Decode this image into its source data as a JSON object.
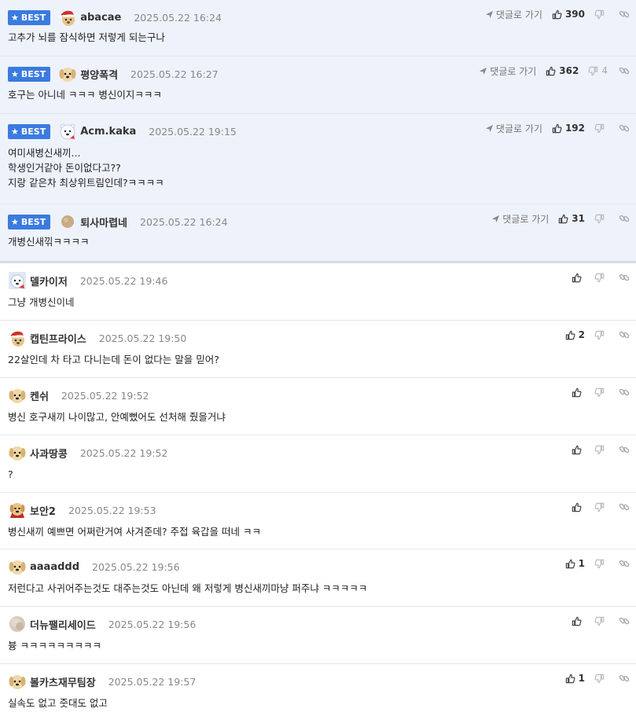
{
  "ui": {
    "best_label": "BEST",
    "reply_link_label": "댓글로 가기"
  },
  "comments": [
    {
      "best": true,
      "avatar": "santa-hat-dog",
      "name": "abacae",
      "date": "2025.05.22 16:24",
      "text": "고추가 뇌를 잠식하면 저렇게 되는구나",
      "likes": "390",
      "dislikes": ""
    },
    {
      "best": true,
      "avatar": "puppy",
      "name": "평양폭격",
      "date": "2025.05.22 16:27",
      "text": "호구는 아니네 ㅋㅋㅋ 병신이지ㅋㅋㅋ",
      "likes": "362",
      "dislikes": "4"
    },
    {
      "best": true,
      "avatar": "polar-bear",
      "name": "Acm.kaka",
      "date": "2025.05.22 19:15",
      "text": "여미새병신새끼...\n학생인거같아 돈이없다고??\n지랑 같은차 최상위트림인데?ㅋㅋㅋㅋ",
      "likes": "192",
      "dislikes": ""
    },
    {
      "best": true,
      "avatar": "round-dot",
      "name": "퇴사마렵네",
      "date": "2025.05.22 16:24",
      "text": "개병신새끾ㅋㅋㅋㅋ",
      "likes": "31",
      "dislikes": ""
    },
    {
      "best": false,
      "avatar": "polar-bear",
      "name": "델카이저",
      "date": "2025.05.22 19:46",
      "text": "그냥 개병신이네",
      "likes": "",
      "dislikes": ""
    },
    {
      "best": false,
      "avatar": "santa-hat-dog",
      "name": "캡틴프라이스",
      "date": "2025.05.22 19:50",
      "text": "22살인데 차 타고 다니는데 돈이 없다는 말을 믿어?",
      "likes": "2",
      "dislikes": ""
    },
    {
      "best": false,
      "avatar": "puppy",
      "name": "켄쉬",
      "date": "2025.05.22 19:52",
      "text": "병신 호구새끼 나이많고, 안예뻤어도 선처해 줬을거냐",
      "likes": "",
      "dislikes": ""
    },
    {
      "best": false,
      "avatar": "puppy",
      "name": "사과땅콩",
      "date": "2025.05.22 19:52",
      "text": "?",
      "likes": "",
      "dislikes": ""
    },
    {
      "best": false,
      "avatar": "cape-dog",
      "name": "보안2",
      "date": "2025.05.22 19:53",
      "text": "병신새끼 예쁘면 어쩌란거여 사겨준데? 주접 육갑을 떠네 ㅋㅋ",
      "likes": "",
      "dislikes": ""
    },
    {
      "best": false,
      "avatar": "puppy",
      "name": "aaaaddd",
      "date": "2025.05.22 19:56",
      "text": "저런다고 사귀어주는것도 대주는것도 아닌데 왜 저렇게 병신새끼마냥 퍼주냐 ㅋㅋㅋㅋㅋ",
      "likes": "1",
      "dislikes": ""
    },
    {
      "best": false,
      "avatar": "blurred-face",
      "name": "더뉴팰리세이드",
      "date": "2025.05.22 19:56",
      "text": "븅 ㅋㅋㅋㅋㅋㅋㅋㅋㅋ",
      "likes": "",
      "dislikes": ""
    },
    {
      "best": false,
      "avatar": "puppy",
      "name": "볼카츠재무팀장",
      "date": "2025.05.22 19:57",
      "text": "실속도 없고 줏대도 없고",
      "likes": "1",
      "dislikes": ""
    }
  ],
  "colors": {
    "best_bg": "#eef2fb",
    "badge_bg": "#3a7be0",
    "border": "#e4e7ee"
  }
}
